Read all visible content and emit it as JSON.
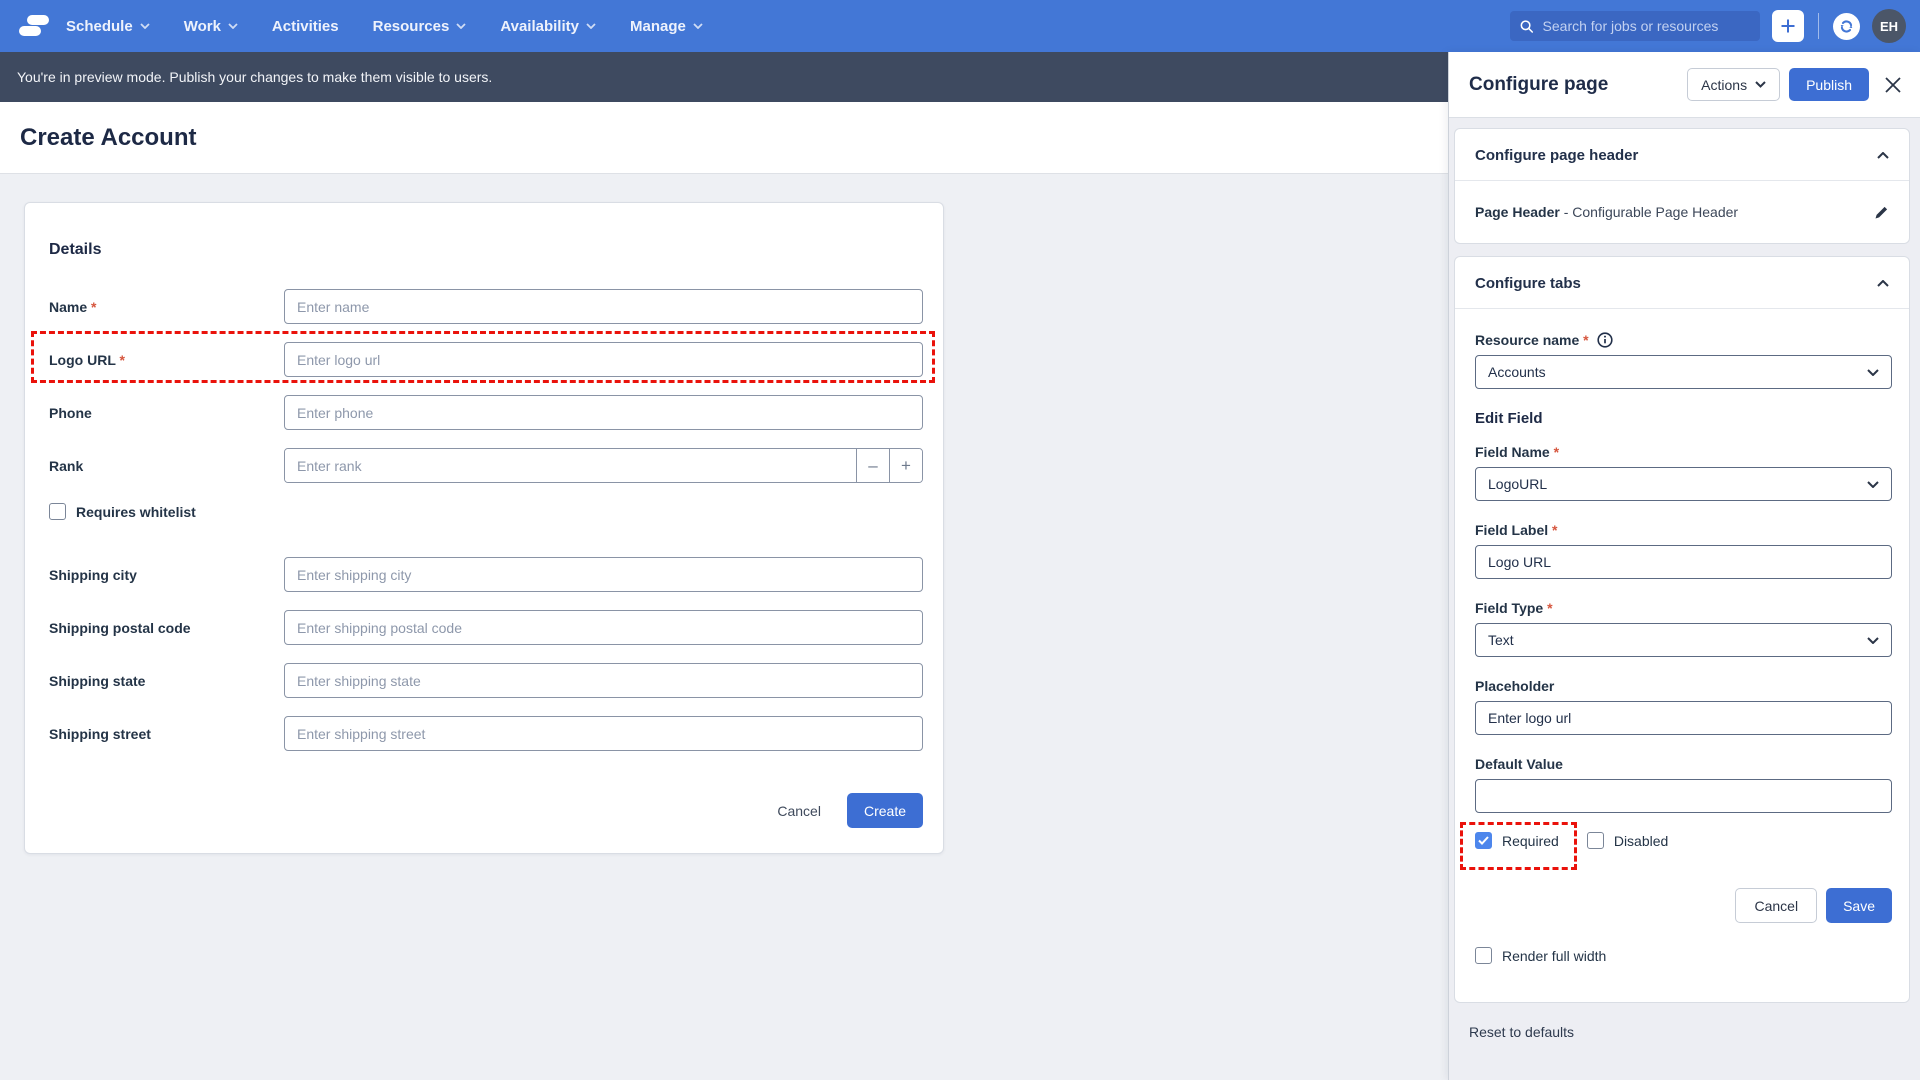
{
  "nav": {
    "items": [
      {
        "label": "Schedule",
        "has_menu": true
      },
      {
        "label": "Work",
        "has_menu": true
      },
      {
        "label": "Activities",
        "has_menu": false
      },
      {
        "label": "Resources",
        "has_menu": true
      },
      {
        "label": "Availability",
        "has_menu": true
      },
      {
        "label": "Manage",
        "has_menu": true
      }
    ],
    "search_placeholder": "Search for jobs or resources",
    "avatar_initials": "EH"
  },
  "banner": {
    "text": "You're in preview mode. Publish your changes to make them visible to users."
  },
  "page": {
    "title": "Create Account"
  },
  "form": {
    "section_title": "Details",
    "fields": [
      {
        "label": "Name",
        "required": true,
        "placeholder": "Enter name"
      },
      {
        "label": "Logo URL",
        "required": true,
        "placeholder": "Enter logo url"
      },
      {
        "label": "Phone",
        "required": false,
        "placeholder": "Enter phone"
      },
      {
        "label": "Rank",
        "required": false,
        "placeholder": "Enter rank"
      },
      {
        "label": "Shipping city",
        "required": false,
        "placeholder": "Enter shipping city"
      },
      {
        "label": "Shipping postal code",
        "required": false,
        "placeholder": "Enter shipping postal code"
      },
      {
        "label": "Shipping state",
        "required": false,
        "placeholder": "Enter shipping state"
      },
      {
        "label": "Shipping street",
        "required": false,
        "placeholder": "Enter shipping street"
      }
    ],
    "rank_stepper": {
      "minus": "–",
      "plus": "+"
    },
    "whitelist_checkbox": {
      "label": "Requires whitelist",
      "checked": false
    },
    "cancel_label": "Cancel",
    "create_label": "Create"
  },
  "panel": {
    "title": "Configure page",
    "actions_label": "Actions",
    "publish_label": "Publish",
    "header_section": {
      "title": "Configure page header",
      "item_name": "Page Header",
      "item_desc": " - Configurable Page Header"
    },
    "tabs_section": {
      "title": "Configure tabs",
      "resource_label": "Resource name",
      "resource_value": "Accounts",
      "edit_field_title": "Edit Field",
      "field_name_label": "Field Name",
      "field_name_value": "LogoURL",
      "field_label_label": "Field Label",
      "field_label_value": "Logo URL",
      "field_type_label": "Field Type",
      "field_type_value": "Text",
      "placeholder_label": "Placeholder",
      "placeholder_value": "Enter logo url",
      "default_value_label": "Default Value",
      "default_value": "",
      "required_checkbox": {
        "label": "Required",
        "checked": true
      },
      "disabled_checkbox": {
        "label": "Disabled",
        "checked": false
      },
      "cancel_label": "Cancel",
      "save_label": "Save",
      "render_full_width_checkbox": {
        "label": "Render full width",
        "checked": false
      }
    },
    "reset_label": "Reset to defaults"
  },
  "colors": {
    "nav_blue": "#4377d6",
    "search_bg": "#3b67c2",
    "banner_bg": "#3e4a60",
    "primary_blue": "#3d6ed3",
    "checkbox_checked_blue": "#4d86ec",
    "annotation_red": "#ea120b",
    "asterisk_red": "#d6563e",
    "avatar_bg": "#4b5668",
    "page_bg": "#eef0f4"
  }
}
